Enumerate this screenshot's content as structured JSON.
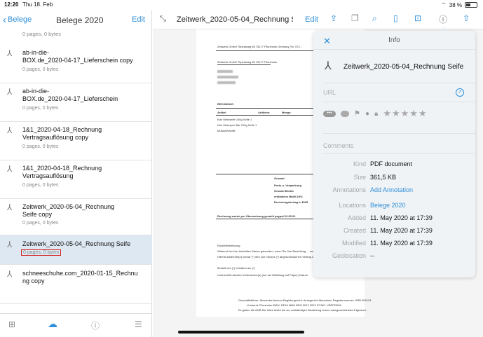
{
  "status": {
    "time": "12:20",
    "date": "Thu 18. Feb",
    "battery": "38 %"
  },
  "sidebar": {
    "back_label": "Belege",
    "title": "Belege 2020",
    "edit_label": "Edit",
    "summary": "0 pages, 0 bytes",
    "items": [
      {
        "name": "ab-in-die-BOX.de_2020-04-17_Lieferschein copy",
        "line1": "ab-in-die-",
        "line2": "BOX.de_2020-04-17_Lieferschein copy",
        "meta": "0 pages, 0 bytes"
      },
      {
        "name": "ab-in-die-BOX.de_2020-04-17_Lieferschein",
        "line1": "ab-in-die-",
        "line2": "BOX.de_2020-04-17_Lieferschein",
        "meta": "0 pages, 0 bytes"
      },
      {
        "name": "1&1_2020-04-18_Rechnung Vertragsauflösung copy",
        "line1": "1&1_2020-04-18_Rechnung",
        "line2": "Vertragsauflösung copy",
        "meta": "0 pages, 0 bytes"
      },
      {
        "name": "1&1_2020-04-18_Rechnung Vertragsauflösung",
        "line1": "1&1_2020-04-18_Rechnung",
        "line2": "Vertragsauflösung",
        "meta": "0 pages, 0 bytes"
      },
      {
        "name": "Zeitwerk_2020-05-04_Rechnung Seife copy",
        "line1": "Zeitwerk_2020-05-04_Rechnung",
        "line2": "Seife copy",
        "meta": "0 pages, 0 bytes"
      },
      {
        "name": "Zeitwerk_2020-05-04_Rechnung Seife",
        "line1": "Zeitwerk_2020-05-04_Rechnung Seife",
        "line2": "",
        "meta": "0 pages, 0 bytes"
      },
      {
        "name": "schneeschuhe.com_2020-01-15_Rechnung copy",
        "line1": "schneeschuhe.com_2020-01-15_Rechnu",
        "line2": "ng copy",
        "meta": "0 pages, 0 bytes"
      }
    ]
  },
  "main": {
    "doc_title": "Zeitwerk_2020-05-04_Rechnung S...",
    "edit_label": "Edit"
  },
  "document": {
    "sender_line": "Zeitwerk GmbH  Tirpestweg 65  75177 Pforzheim  Germany  Tel. 072...",
    "sender_small": "Zeitwerk GmbH  Tirpestweg 65  75177 Pforzheim",
    "heading": "RECHNUNG",
    "col_artikel": "Artikel",
    "col_nr": "Artikelnr.",
    "col_menge": "Menge",
    "row1": "Klar Weinseife      100g      Seife        1",
    "row2": "Klar Shampoo Bar    100g      Seife        1",
    "row3": "Muskat/Vanille",
    "gesamt": "Gesamt",
    "porto": "Porto u. Verpackung",
    "brutto": "Gesamt Brutto",
    "mwst": "enthaltene MwSt.19%",
    "betrag": "Rechnungsbetrag in EUR",
    "paid": "Rechnung wurde per Überweisung gezahlt     paypal 02.05.20",
    "note1": "Rücktrittbelehrung",
    "note2": "Widerruf der hier bestellten Waren gebunden, wenn Sie Ihre Bestellung ... und senden Sie an",
    "note3": "Hiermit widerrufe(n) ich/wir (*) den von mir/uns (*) abgeschlossenen Vertrag über den Kauf der folgenden Waren",
    "note4": "Bestellt am (*)                     /erhalten am (*)",
    "note5": "Unterschrift des/der Verbraucher(s) (nur bei Mitteilung auf Papier)                   Datum",
    "footer1": "Geschäftsführer: Alexandra Amiova   Registergericht: Amtsgericht Mannheim Registernummer: HRB 505134",
    "footer2": "Vorstand: Pforzheim    IBAN: DE18 6666 0000 0012 3922 87    BIC: VBPFDE66",
    "footer3": "Es gelten die AGB Die Ware bleibt bis zur vollständigen Bezahlung unser uneingeschränktes Eigentum."
  },
  "info": {
    "title": "Info",
    "file_name": "Zeitwerk_2020-05-04_Rechnung Seife",
    "url_label": "URL",
    "comments_label": "Comments",
    "tag_more": "•••",
    "stars": "★★★★★",
    "kind_key": "Kind",
    "kind_val": "PDF document",
    "size_key": "Size",
    "size_val": "361,5 KB",
    "annotations_key": "Annotations",
    "annotations_val": "Add Annotation",
    "locations_key": "Locations",
    "locations_val": "Belege 2020",
    "added_key": "Added",
    "added_val": "11. May 2020 at 17:39",
    "created_key": "Created",
    "created_val": "11. May 2020 at 17:39",
    "modified_key": "Modified",
    "modified_val": "11. May 2020 at 17:39",
    "geolocation_key": "Geolocation",
    "geolocation_val": "--"
  },
  "colors": {
    "accent": "#2f8fd8",
    "selected_row": "#dde8f3",
    "highlight_box": "#d32020"
  }
}
